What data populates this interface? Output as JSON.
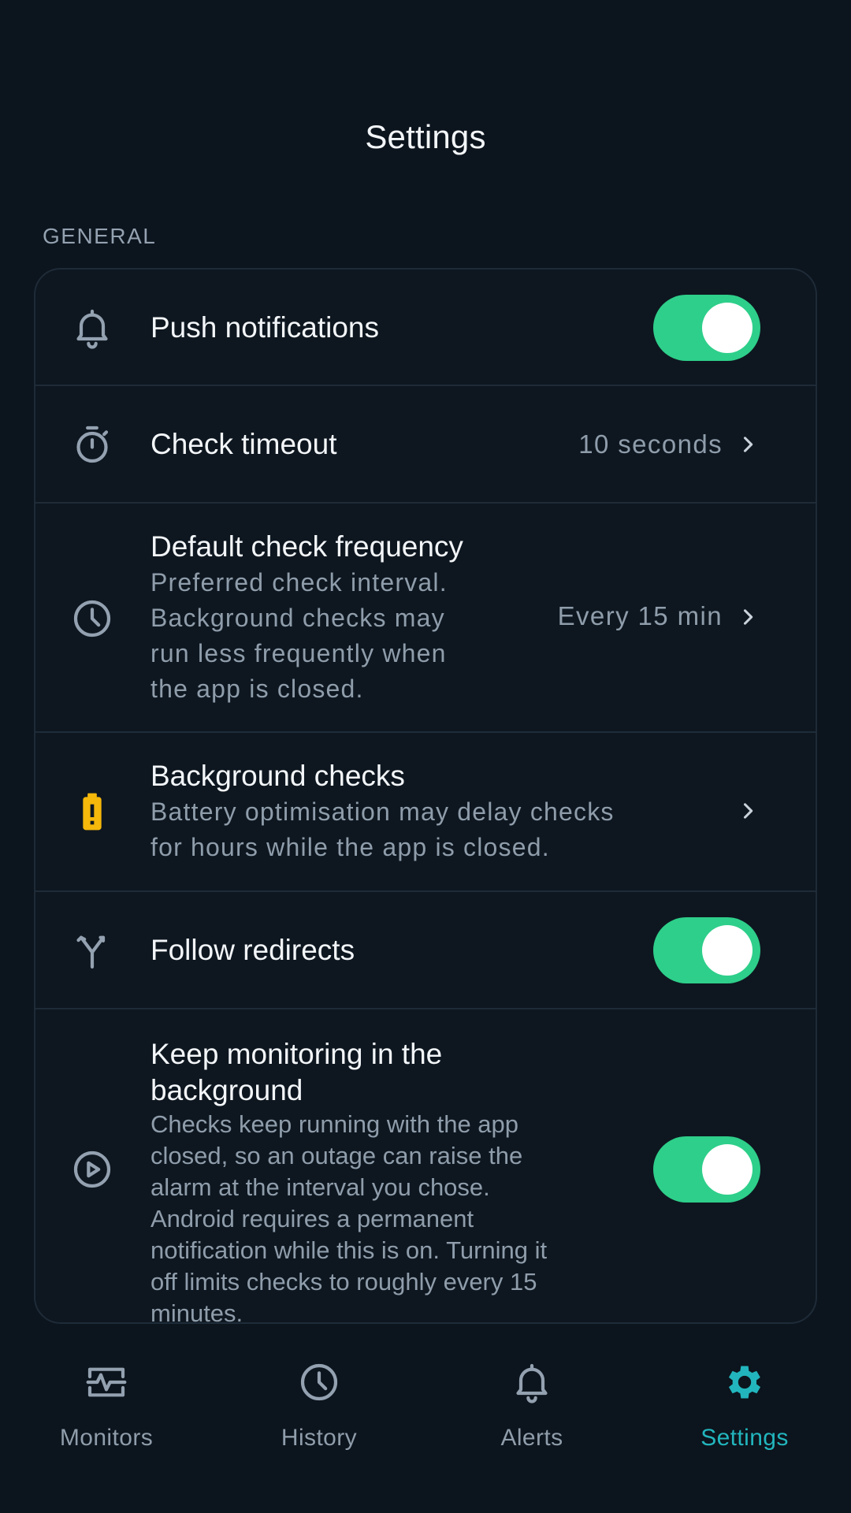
{
  "header": {
    "title": "Settings"
  },
  "section": {
    "label": "GENERAL"
  },
  "settings": {
    "push_notifications": {
      "title": "Push notifications",
      "enabled": true,
      "icon": "bell-icon"
    },
    "check_timeout": {
      "title": "Check timeout",
      "value": "10 seconds",
      "icon": "stopwatch-icon"
    },
    "default_frequency": {
      "title": "Default check frequency",
      "subtitle_lines": [
        "Preferred check interval.",
        "Background checks may",
        "run less frequently when",
        "the app is closed."
      ],
      "value": "Every 15 min",
      "icon": "clock-icon"
    },
    "background_checks": {
      "title": "Background checks",
      "subtitle_lines": [
        "Battery optimisation may delay checks",
        "for hours while the app is closed."
      ],
      "icon": "battery-alert-icon"
    },
    "follow_redirects": {
      "title": "Follow redirects",
      "enabled": true,
      "icon": "fork-arrows-icon"
    },
    "keep_monitoring": {
      "title_lines": [
        "Keep monitoring in the",
        "background"
      ],
      "subtitle_lines": [
        "Checks keep running with the app",
        "closed, so an outage can raise the",
        "alarm at the interval you chose.",
        "Android requires a permanent",
        "notification while this is on. Turning it",
        "off limits checks to roughly every 15",
        "minutes."
      ],
      "enabled": true,
      "icon": "play-circle-icon"
    }
  },
  "nav": {
    "items": [
      {
        "label": "Monitors",
        "icon": "pulse-monitor-icon",
        "active": false
      },
      {
        "label": "History",
        "icon": "clock-icon",
        "active": false
      },
      {
        "label": "Alerts",
        "icon": "bell-icon",
        "active": false
      },
      {
        "label": "Settings",
        "icon": "gear-icon",
        "active": true
      }
    ]
  },
  "colors": {
    "background": "#0c141d",
    "card": "#0e1720",
    "divider": "#1e2b38",
    "toggle_on": "#2ecf8a",
    "accent": "#22b5bd",
    "warning": "#f5b80b",
    "muted_text": "#8f9dab"
  }
}
